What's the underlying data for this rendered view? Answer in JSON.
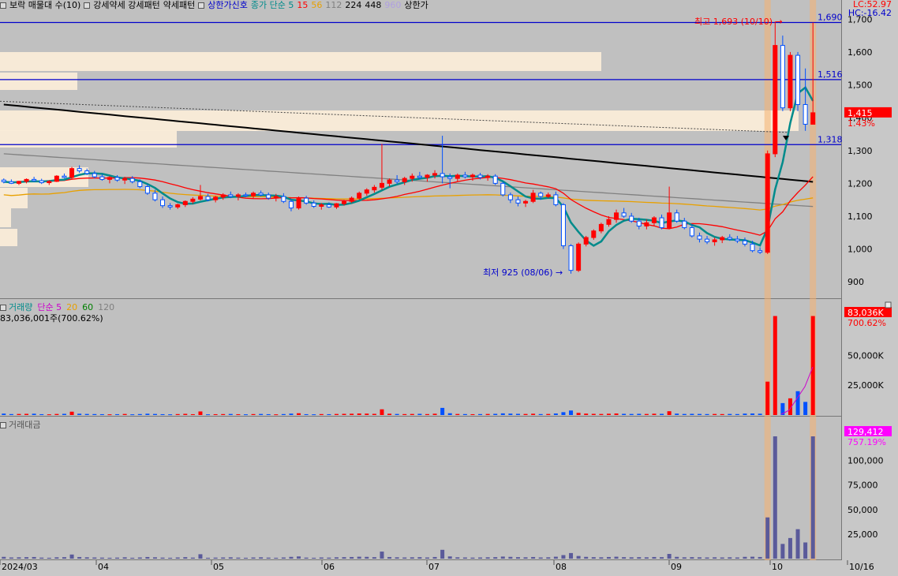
{
  "legend": {
    "items": [
      {
        "label": "보락 매물대 수(10)",
        "color": "#000000"
      },
      {
        "label": "강세약세 강세패턴",
        "color": "#000000"
      },
      {
        "label": "약세패턴",
        "color": "#000000"
      },
      {
        "label": "상한가신호",
        "color": "#0000cc"
      },
      {
        "label": "종가 단순 5",
        "color": "#008b8b"
      },
      {
        "label": "15",
        "color": "#ff0000"
      },
      {
        "label": "56",
        "color": "#e8a000"
      },
      {
        "label": "112",
        "color": "#808080"
      },
      {
        "label": "224",
        "color": "#000000"
      },
      {
        "label": "448",
        "color": "#000000"
      },
      {
        "label": "960",
        "color": "#b0a0e0"
      },
      {
        "label": "상한가",
        "color": "#000000"
      }
    ]
  },
  "readouts": {
    "lc": "LC:52.97",
    "hc": "HC:-16.42"
  },
  "volume_pane": {
    "legend": [
      {
        "label": "거래량",
        "color": "#008b8b"
      },
      {
        "label": "단순 5",
        "color": "#cc00cc"
      },
      {
        "label": "20",
        "color": "#e8a000"
      },
      {
        "label": "60",
        "color": "#008000"
      },
      {
        "label": "120",
        "color": "#808080"
      }
    ],
    "value_text": "83,036,001주(700.62%)",
    "badge": "83,036K",
    "badge_pct": "700.62%"
  },
  "amount_pane": {
    "legend": "거래대금",
    "badge": "129,412",
    "badge_pct": "757.19%"
  },
  "chart_data": [
    {
      "type": "candlestick",
      "name": "price",
      "ylim": [
        850,
        1720
      ],
      "y_ticks": [
        "900",
        "1,000",
        "1,100",
        "1,200",
        "1,300",
        "1,400",
        "1,500",
        "1,600",
        "1,700"
      ],
      "y_tick_values": [
        900,
        1000,
        1100,
        1200,
        1300,
        1400,
        1500,
        1600,
        1700
      ],
      "x_labels": [
        "2024/03",
        "04",
        "05",
        "06",
        "07",
        "08",
        "09",
        "10",
        "10/16"
      ],
      "hlines": [
        {
          "value": 1690,
          "label": "1,690"
        },
        {
          "value": 1516,
          "label": "1,516"
        },
        {
          "value": 1318,
          "label": "1,318"
        }
      ],
      "current_price": {
        "value": 1415,
        "label": "1,415",
        "pct": "1.43%"
      },
      "annotations": {
        "high": {
          "value": 1693,
          "text": "최고 1,693 (10/10)"
        },
        "low": {
          "value": 925,
          "text": "최저 925 (08/06)"
        }
      },
      "candles": [
        [
          1210,
          1215,
          1200,
          1205
        ],
        [
          1205,
          1212,
          1198,
          1200
        ],
        [
          1200,
          1208,
          1195,
          1206
        ],
        [
          1206,
          1215,
          1200,
          1212
        ],
        [
          1212,
          1220,
          1205,
          1208
        ],
        [
          1208,
          1214,
          1198,
          1202
        ],
        [
          1202,
          1210,
          1195,
          1206
        ],
        [
          1206,
          1225,
          1204,
          1222
        ],
        [
          1222,
          1230,
          1215,
          1218
        ],
        [
          1218,
          1250,
          1212,
          1245
        ],
        [
          1245,
          1255,
          1232,
          1238
        ],
        [
          1238,
          1245,
          1225,
          1230
        ],
        [
          1230,
          1238,
          1215,
          1220
        ],
        [
          1220,
          1228,
          1208,
          1212
        ],
        [
          1212,
          1222,
          1200,
          1218
        ],
        [
          1218,
          1225,
          1205,
          1210
        ],
        [
          1210,
          1220,
          1198,
          1215
        ],
        [
          1215,
          1222,
          1200,
          1205
        ],
        [
          1205,
          1212,
          1185,
          1190
        ],
        [
          1190,
          1198,
          1165,
          1170
        ],
        [
          1170,
          1180,
          1145,
          1150
        ],
        [
          1150,
          1160,
          1125,
          1132
        ],
        [
          1132,
          1140,
          1120,
          1128
        ],
        [
          1128,
          1138,
          1122,
          1135
        ],
        [
          1135,
          1148,
          1128,
          1145
        ],
        [
          1145,
          1158,
          1138,
          1152
        ],
        [
          1152,
          1195,
          1148,
          1160
        ],
        [
          1160,
          1168,
          1145,
          1150
        ],
        [
          1150,
          1162,
          1142,
          1158
        ],
        [
          1158,
          1170,
          1150,
          1165
        ],
        [
          1165,
          1175,
          1155,
          1160
        ],
        [
          1160,
          1170,
          1148,
          1165
        ],
        [
          1165,
          1172,
          1158,
          1162
        ],
        [
          1162,
          1175,
          1155,
          1170
        ],
        [
          1170,
          1178,
          1160,
          1165
        ],
        [
          1165,
          1172,
          1150,
          1155
        ],
        [
          1155,
          1168,
          1145,
          1160
        ],
        [
          1160,
          1170,
          1140,
          1145
        ],
        [
          1145,
          1152,
          1115,
          1125
        ],
        [
          1125,
          1160,
          1120,
          1155
        ],
        [
          1155,
          1162,
          1135,
          1140
        ],
        [
          1140,
          1148,
          1125,
          1130
        ],
        [
          1130,
          1140,
          1120,
          1135
        ],
        [
          1135,
          1142,
          1125,
          1128
        ],
        [
          1128,
          1140,
          1122,
          1138
        ],
        [
          1138,
          1150,
          1132,
          1145
        ],
        [
          1145,
          1160,
          1140,
          1155
        ],
        [
          1155,
          1175,
          1150,
          1170
        ],
        [
          1170,
          1185,
          1162,
          1180
        ],
        [
          1180,
          1195,
          1172,
          1188
        ],
        [
          1188,
          1320,
          1180,
          1200
        ],
        [
          1200,
          1215,
          1190,
          1210
        ],
        [
          1210,
          1225,
          1198,
          1205
        ],
        [
          1205,
          1220,
          1195,
          1215
        ],
        [
          1215,
          1230,
          1205,
          1222
        ],
        [
          1222,
          1235,
          1212,
          1218
        ],
        [
          1218,
          1228,
          1205,
          1225
        ],
        [
          1225,
          1240,
          1215,
          1230
        ],
        [
          1230,
          1345,
          1200,
          1220
        ],
        [
          1220,
          1230,
          1185,
          1215
        ],
        [
          1215,
          1230,
          1205,
          1225
        ],
        [
          1225,
          1235,
          1215,
          1220
        ],
        [
          1220,
          1230,
          1208,
          1225
        ],
        [
          1225,
          1232,
          1212,
          1218
        ],
        [
          1218,
          1228,
          1208,
          1222
        ],
        [
          1222,
          1228,
          1195,
          1200
        ],
        [
          1200,
          1205,
          1160,
          1165
        ],
        [
          1165,
          1172,
          1140,
          1150
        ],
        [
          1150,
          1160,
          1130,
          1140
        ],
        [
          1140,
          1150,
          1128,
          1145
        ],
        [
          1145,
          1180,
          1140,
          1170
        ],
        [
          1170,
          1175,
          1150,
          1160
        ],
        [
          1160,
          1172,
          1155,
          1165
        ],
        [
          1165,
          1175,
          1130,
          1135
        ],
        [
          1135,
          1140,
          1000,
          1010
        ],
        [
          1010,
          1015,
          925,
          935
        ],
        [
          935,
          1020,
          930,
          1015
        ],
        [
          1015,
          1040,
          1008,
          1035
        ],
        [
          1035,
          1060,
          1028,
          1055
        ],
        [
          1055,
          1080,
          1048,
          1075
        ],
        [
          1075,
          1100,
          1068,
          1090
        ],
        [
          1090,
          1120,
          1080,
          1110
        ],
        [
          1110,
          1125,
          1095,
          1100
        ],
        [
          1100,
          1110,
          1080,
          1085
        ],
        [
          1085,
          1095,
          1060,
          1070
        ],
        [
          1070,
          1090,
          1060,
          1080
        ],
        [
          1080,
          1100,
          1070,
          1095
        ],
        [
          1095,
          1105,
          1060,
          1065
        ],
        [
          1065,
          1190,
          1060,
          1110
        ],
        [
          1110,
          1120,
          1080,
          1085
        ],
        [
          1085,
          1095,
          1060,
          1065
        ],
        [
          1065,
          1075,
          1035,
          1040
        ],
        [
          1040,
          1050,
          1020,
          1030
        ],
        [
          1030,
          1040,
          1015,
          1022
        ],
        [
          1022,
          1035,
          1010,
          1028
        ],
        [
          1028,
          1040,
          1018,
          1035
        ],
        [
          1035,
          1045,
          1025,
          1030
        ],
        [
          1030,
          1040,
          1018,
          1025
        ],
        [
          1025,
          1035,
          1008,
          1015
        ],
        [
          1015,
          1025,
          990,
          995
        ],
        [
          995,
          1005,
          985,
          990
        ],
        [
          990,
          1300,
          985,
          1290
        ],
        [
          1290,
          1693,
          1280,
          1620
        ],
        [
          1620,
          1650,
          1420,
          1430
        ],
        [
          1430,
          1600,
          1420,
          1590
        ],
        [
          1590,
          1600,
          1420,
          1440
        ],
        [
          1440,
          1550,
          1360,
          1380
        ],
        [
          1380,
          1690,
          1380,
          1415
        ]
      ],
      "ma": [
        {
          "period": "5",
          "color": "#008b8b"
        },
        {
          "period": "15",
          "color": "#ff0000"
        },
        {
          "period": "56",
          "color": "#e8a000"
        },
        {
          "period": "112",
          "color": "#808080"
        },
        {
          "period": "224",
          "color": "#000000"
        }
      ]
    },
    {
      "type": "bar",
      "name": "volume",
      "ylim": [
        0,
        90000
      ],
      "y_ticks": [
        "25,000K",
        "50,000K"
      ],
      "y_tick_values": [
        25000,
        50000
      ],
      "last_values_k": [
        1200,
        800,
        900,
        1000,
        1100,
        700,
        600,
        900,
        1000,
        2800,
        1100,
        900,
        800,
        700,
        600,
        700,
        900,
        600,
        800,
        1100,
        900,
        700,
        600,
        800,
        1000,
        700,
        3000,
        600,
        700,
        800,
        900,
        700,
        600,
        800,
        900,
        700,
        600,
        800,
        1200,
        1500,
        700,
        600,
        800,
        700,
        900,
        1000,
        1100,
        1300,
        1200,
        1000,
        4800,
        1100,
        900,
        800,
        900,
        1000,
        800,
        1100,
        6000,
        1500,
        900,
        800,
        700,
        800,
        900,
        1000,
        1400,
        1200,
        1000,
        900,
        1100,
        800,
        900,
        1300,
        2400,
        3800,
        1800,
        1200,
        1000,
        900,
        1100,
        1300,
        1000,
        900,
        1000,
        900,
        1100,
        1000,
        3200,
        1200,
        900,
        1000,
        900,
        800,
        900,
        800,
        900,
        800,
        1200,
        1300,
        1100,
        28000,
        83036,
        10000,
        14000,
        20000,
        11000,
        83036
      ]
    },
    {
      "type": "bar",
      "name": "amount",
      "ylim": [
        0,
        135000
      ],
      "y_ticks": [
        "25,000",
        "50,000",
        "75,000",
        "100,000"
      ],
      "y_tick_values": [
        25000,
        50000,
        75000,
        100000
      ]
    }
  ]
}
